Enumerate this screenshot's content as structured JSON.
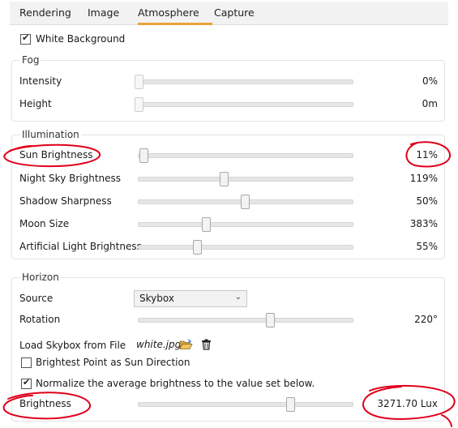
{
  "tabs": [
    {
      "label": "Rendering"
    },
    {
      "label": "Image"
    },
    {
      "label": "Atmosphere",
      "active": true
    },
    {
      "label": "Capture"
    }
  ],
  "white_background": {
    "label": "White Background",
    "checked": true
  },
  "fog": {
    "title": "Fog",
    "intensity": {
      "label": "Intensity",
      "value": "0%",
      "level": 0
    },
    "height": {
      "label": "Height",
      "value": "0m",
      "level": 0
    }
  },
  "illumination": {
    "title": "Illumination",
    "sun_brightness": {
      "label": "Sun Brightness",
      "value": "11%",
      "level": 0.02
    },
    "night_sky_brightness": {
      "label": "Night Sky Brightness",
      "value": "119%",
      "level": 0.39
    },
    "shadow_sharpness": {
      "label": "Shadow Sharpness",
      "value": "50%",
      "level": 0.5
    },
    "moon_size": {
      "label": "Moon Size",
      "value": "383%",
      "level": 0.31
    },
    "artificial_light_brightness": {
      "label": "Artificial Light Brightness",
      "value": "55%",
      "level": 0.27
    }
  },
  "horizon": {
    "title": "Horizon",
    "source": {
      "label": "Source",
      "selected": "Skybox"
    },
    "rotation": {
      "label": "Rotation",
      "value": "220°",
      "level": 0.6
    },
    "load_skybox": {
      "label": "Load Skybox from File",
      "filename": "white.jpg",
      "open_icon": "folder-open-icon",
      "delete_icon": "trash-icon"
    },
    "brightest_point": {
      "label": "Brightest Point as Sun Direction",
      "checked": false
    },
    "normalize": {
      "label": "Normalize the average brightness to the value set below.",
      "checked": true
    },
    "brightness": {
      "label": "Brightness",
      "value": "3271.70 Lux",
      "level": 0.7
    }
  },
  "colors": {
    "accent": "#e8a33a",
    "annotation": "#e0001b"
  }
}
